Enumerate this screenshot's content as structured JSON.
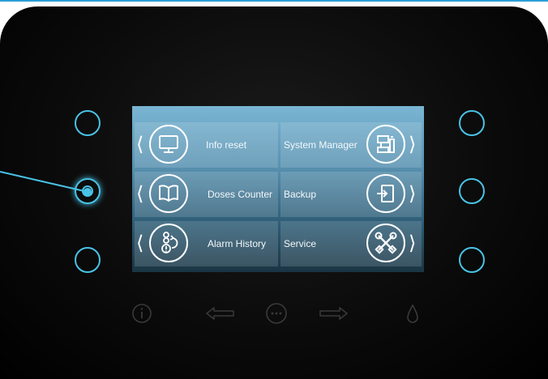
{
  "menu": {
    "left": [
      {
        "label": "Info reset",
        "icon": "monitor-icon"
      },
      {
        "label": "Doses Counter",
        "icon": "book-icon"
      },
      {
        "label": "Alarm History",
        "icon": "alarm-icon"
      }
    ],
    "right": [
      {
        "label": "System Manager",
        "icon": "machine-icon"
      },
      {
        "label": "Backup",
        "icon": "backup-icon"
      },
      {
        "label": "Service",
        "icon": "tools-icon"
      }
    ]
  },
  "bottom_bar": {
    "icons": [
      "info-icon",
      "arrow-left-icon",
      "more-icon",
      "arrow-right-icon",
      "drop-icon"
    ]
  },
  "colors": {
    "accent": "#49c3e6",
    "screen_top": "#7ab6d4",
    "bezel": "#0b0b0b"
  }
}
